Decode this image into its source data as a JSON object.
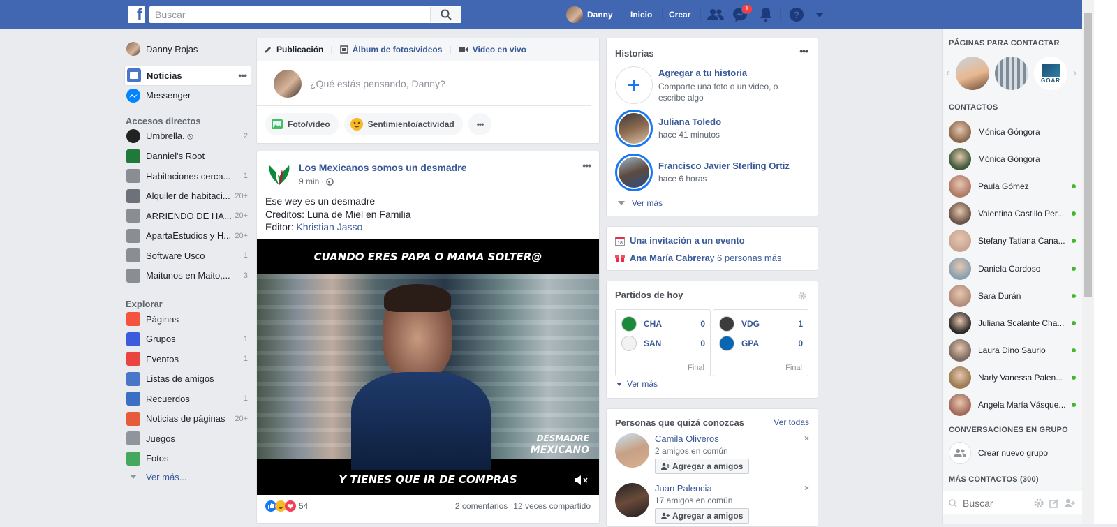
{
  "topbar": {
    "logo": "f",
    "search_placeholder": "Buscar",
    "user_name": "Danny",
    "nav_home": "Inicio",
    "nav_create": "Crear",
    "messages_badge": "1",
    "icons": [
      "friends-icon",
      "messenger-icon",
      "bell-icon",
      "help-icon",
      "caret-icon"
    ],
    "brand_color": "#4267b2"
  },
  "left_nav": {
    "profile": "Danny Rojas",
    "items": [
      {
        "label": "Noticias",
        "count": "",
        "icon": "news-feed-icon"
      },
      {
        "label": "Messenger",
        "count": "",
        "icon": "messenger-icon"
      }
    ],
    "shortcuts_title": "Accesos directos",
    "shortcuts": [
      {
        "label": "Umbrella. ⦸",
        "count": "2"
      },
      {
        "label": "Danniel's Root",
        "count": ""
      },
      {
        "label": "Habitaciones cerca...",
        "count": "1"
      },
      {
        "label": "Alquiler de habitaci...",
        "count": "20+"
      },
      {
        "label": "ARRIENDO DE HA...",
        "count": "20+"
      },
      {
        "label": "ApartaEstudios y H...",
        "count": "20+"
      },
      {
        "label": "Software Usco",
        "count": "1"
      },
      {
        "label": "Maitunos en Maito,...",
        "count": "3"
      }
    ],
    "explore_title": "Explorar",
    "explore": [
      {
        "label": "Páginas",
        "count": ""
      },
      {
        "label": "Grupos",
        "count": "1"
      },
      {
        "label": "Eventos",
        "count": "1"
      },
      {
        "label": "Listas de amigos",
        "count": ""
      },
      {
        "label": "Recuerdos",
        "count": "1"
      },
      {
        "label": "Noticias de páginas",
        "count": "20+"
      },
      {
        "label": "Juegos",
        "count": ""
      },
      {
        "label": "Fotos",
        "count": ""
      }
    ],
    "see_more": "Ver más..."
  },
  "composer": {
    "tab_post": "Publicación",
    "tab_album": "Álbum de fotos/videos",
    "tab_live": "Video en vivo",
    "placeholder": "¿Qué estás pensando, Danny?",
    "btn_photo": "Foto/video",
    "btn_feeling": "Sentimiento/actividad"
  },
  "post": {
    "page_name": "Los Mexicanos somos un desmadre",
    "time": "9 min",
    "line1": "Ese wey es un desmadre",
    "line2": "Creditos: Luna de Miel en Familia",
    "editor_prefix": "Editor: ",
    "editor_name": "Khristian Jasso",
    "video_top": "CUANDO ERES PAPA O MAMA SOLTER@",
    "video_bottom": "Y TIENES QUE IR DE COMPRAS",
    "watermark1": "DESMADRE",
    "watermark2": "MEXICANO",
    "reactions": "54",
    "comments": "2 comentarios",
    "shares": "12 veces compartido"
  },
  "stories": {
    "title": "Historias",
    "add_title": "Agregar a tu historia",
    "add_sub": "Comparte una foto o un video, o escribe algo",
    "items": [
      {
        "name": "Juliana Toledo",
        "time": "hace 41 minutos"
      },
      {
        "name": "Francisco Javier Sterling Ortiz",
        "time": "hace 6 horas"
      }
    ],
    "see_more": "Ver más"
  },
  "events": {
    "invite": "Una invitación a un evento",
    "birthday_name": "Ana María Cabrera",
    "birthday_rest": " y 6 personas más"
  },
  "matches": {
    "title": "Partidos de hoy",
    "games": [
      {
        "home": "CHA",
        "home_score": "0",
        "away": "SAN",
        "away_score": "0",
        "status": "Final"
      },
      {
        "home": "VDG",
        "home_score": "1",
        "away": "GPA",
        "away_score": "0",
        "status": "Final"
      }
    ],
    "see_more": "Ver más"
  },
  "pymk": {
    "title": "Personas que quizá conozcas",
    "see_all": "Ver todas",
    "people": [
      {
        "name": "Camila Oliveros",
        "mutual": "2 amigos en común",
        "button": "Agregar a amigos"
      },
      {
        "name": "Juan Palencia",
        "mutual": "17 amigos en común",
        "button": "Agregar a amigos"
      }
    ]
  },
  "chat": {
    "pages_title": "PÁGINAS PARA CONTACTAR",
    "page_logo_text": "GOAR",
    "contacts_title": "CONTACTOS",
    "contacts": [
      {
        "name": "Mónica Góngora",
        "online": false
      },
      {
        "name": "Mónica Góngora",
        "online": false
      },
      {
        "name": "Paula Gómez",
        "online": true
      },
      {
        "name": "Valentina Castillo Per...",
        "online": true
      },
      {
        "name": "Stefany Tatiana Cana...",
        "online": true
      },
      {
        "name": "Daniela Cardoso",
        "online": true
      },
      {
        "name": "Sara Durán",
        "online": true
      },
      {
        "name": "Juliana Scalante Cha...",
        "online": true
      },
      {
        "name": "Laura Dino Saurio",
        "online": true
      },
      {
        "name": "Narly Vanessa Palen...",
        "online": true
      },
      {
        "name": "Angela María Vásque...",
        "online": true
      }
    ],
    "groups_title": "CONVERSACIONES EN GRUPO",
    "new_group": "Crear nuevo grupo",
    "more_contacts": "MÁS CONTACTOS (300)",
    "search_placeholder": "Buscar"
  }
}
